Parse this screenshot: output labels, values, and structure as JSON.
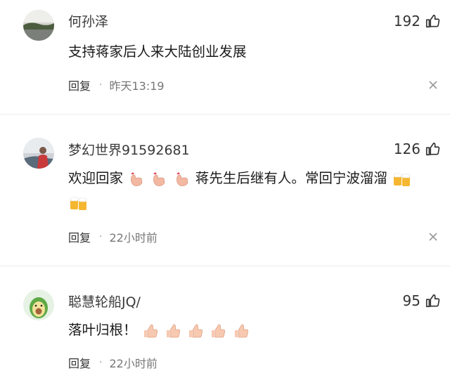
{
  "comments": [
    {
      "username": "何孙泽",
      "likes": "192",
      "text": "支持蒋家后人来大陆创业发展",
      "reply_label": "回复",
      "separator": "·",
      "time": "昨天13:19"
    },
    {
      "username": "梦幻世界91592681",
      "likes": "126",
      "text_part1": "欢迎回家",
      "text_part2": "蒋先生后继有人。常回宁波溜溜",
      "reply_label": "回复",
      "separator": "·",
      "time": "22小时前"
    },
    {
      "username": "聪慧轮船JQ/",
      "likes": "95",
      "text": "落叶归根！",
      "reply_label": "回复",
      "separator": "·",
      "time": "22小时前"
    }
  ],
  "icons": {
    "like": "thumbs-up-icon",
    "close": "close-icon",
    "emoji_finger_heart": "finger-heart-emoji",
    "emoji_beer": "beer-mugs-emoji",
    "emoji_thumbs": "thumbs-up-emoji"
  }
}
